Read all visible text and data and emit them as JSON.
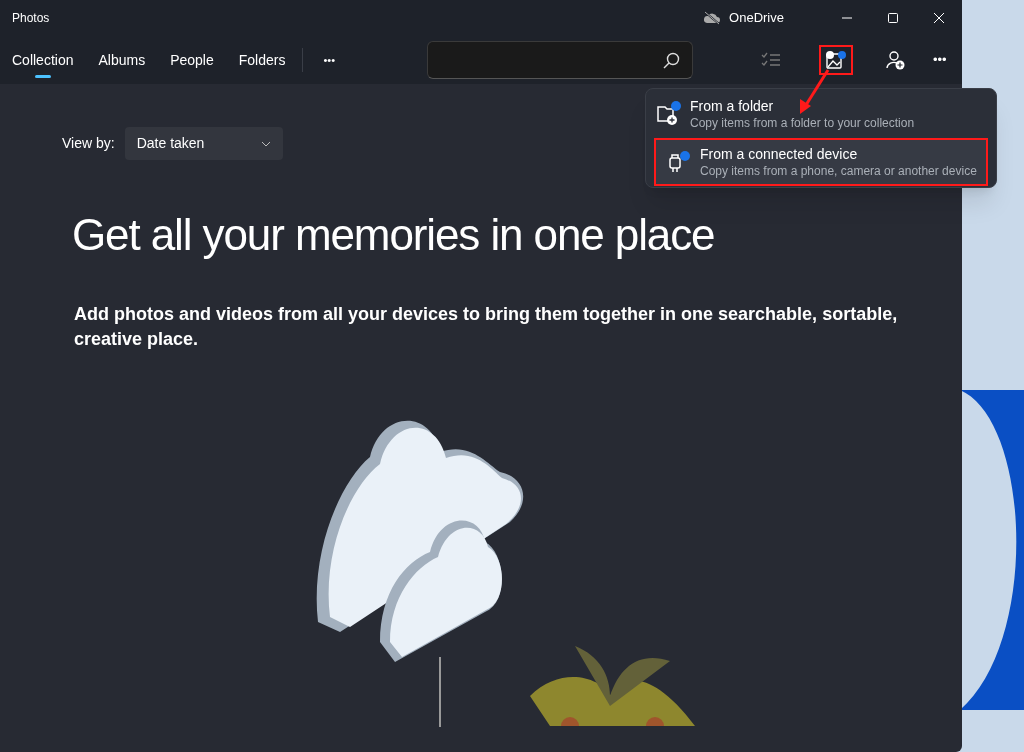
{
  "window": {
    "title": "Photos",
    "onedrive_label": "OneDrive"
  },
  "tabs": [
    {
      "label": "Collection",
      "selected": true
    },
    {
      "label": "Albums",
      "selected": false
    },
    {
      "label": "People",
      "selected": false
    },
    {
      "label": "Folders",
      "selected": false
    }
  ],
  "more_tabs": "•••",
  "toolbar_more": "•••",
  "view_by": {
    "label": "View by:",
    "value": "Date taken"
  },
  "heading": "Get all your memories in one place",
  "description": "Add photos and videos from all your devices to bring them together in one searchable, sortable, creative place.",
  "import_menu": [
    {
      "kind": "folder",
      "title": "From a folder",
      "subtitle": "Copy items from a folder to your collection",
      "selected": false
    },
    {
      "kind": "device",
      "title": "From a connected device",
      "subtitle": "Copy items from a phone, camera or another device",
      "selected": true
    }
  ]
}
